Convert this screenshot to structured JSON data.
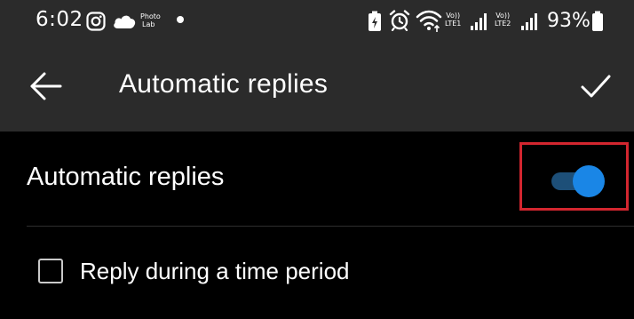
{
  "status_bar": {
    "time": "6:02",
    "notification_app_label_line1": "Photo",
    "notification_app_label_line2": "Lab",
    "sim1_label_top": "Vo))",
    "sim1_label_bottom": "LTE1",
    "sim2_label_top": "Vo))",
    "sim2_label_bottom": "LTE2",
    "battery_percent": "93%",
    "icons": [
      "instagram-icon",
      "cloud-icon",
      "notification-dot",
      "battery-saver-icon",
      "alarm-icon",
      "wifi-icon",
      "signal-icon",
      "battery-icon"
    ]
  },
  "app_bar": {
    "title": "Automatic replies",
    "back_icon": "arrow-left-icon",
    "confirm_icon": "check-icon"
  },
  "settings": {
    "automatic_replies": {
      "label": "Automatic replies",
      "enabled": true
    },
    "time_period": {
      "label": "Reply during a time period",
      "checked": false
    }
  },
  "colors": {
    "app_bar_bg": "#2b2b2b",
    "content_bg": "#000000",
    "toggle_thumb": "#1a86e6",
    "toggle_track": "#1d4f78",
    "highlight_border": "#d3262f"
  }
}
